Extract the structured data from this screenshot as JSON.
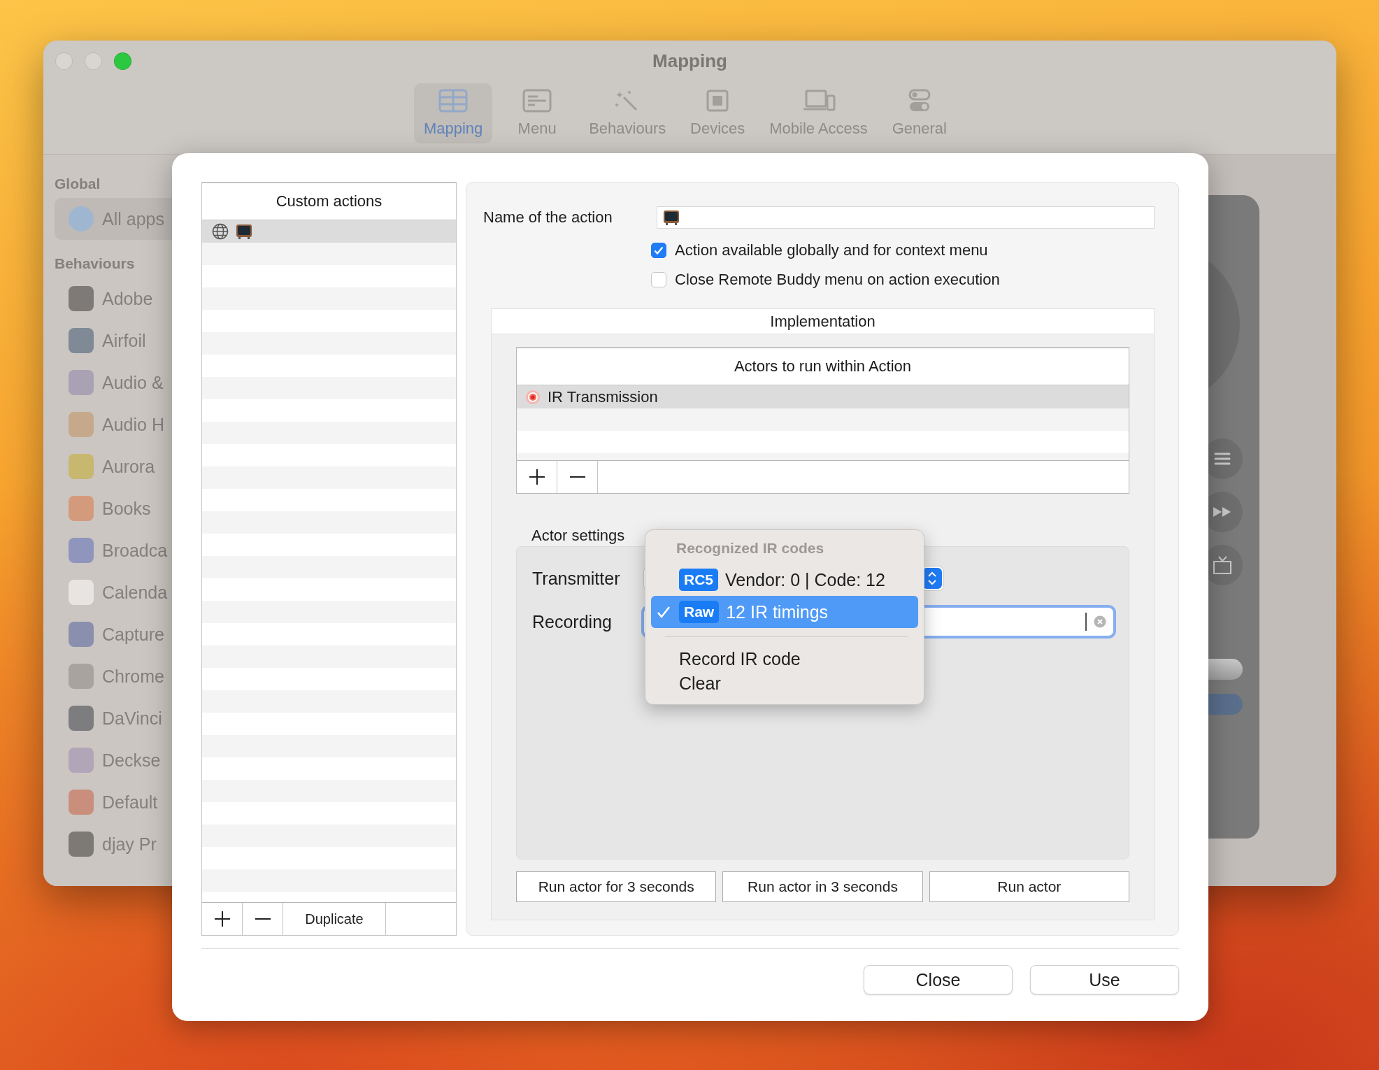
{
  "window": {
    "title": "Mapping"
  },
  "toolbar": [
    {
      "label": "Mapping",
      "selected": true
    },
    {
      "label": "Menu",
      "selected": false
    },
    {
      "label": "Behaviours",
      "selected": false
    },
    {
      "label": "Devices",
      "selected": false
    },
    {
      "label": "Mobile Access",
      "selected": false
    },
    {
      "label": "General",
      "selected": false
    }
  ],
  "sidebar": {
    "sections": [
      {
        "title": "Global",
        "items": [
          {
            "label": "All apps",
            "selected": true
          }
        ]
      },
      {
        "title": "Behaviours",
        "items": [
          {
            "label": "Adobe",
            "selected": false
          },
          {
            "label": "Airfoil",
            "selected": false
          },
          {
            "label": "Audio &",
            "selected": false
          },
          {
            "label": "Audio H",
            "selected": false
          },
          {
            "label": "Aurora",
            "selected": false
          },
          {
            "label": "Books",
            "selected": false
          },
          {
            "label": "Broadca",
            "selected": false
          },
          {
            "label": "Calenda",
            "selected": false
          },
          {
            "label": "Capture",
            "selected": false
          },
          {
            "label": "Chrome",
            "selected": false
          },
          {
            "label": "DaVinci",
            "selected": false
          },
          {
            "label": "Deckse",
            "selected": false
          },
          {
            "label": "Default",
            "selected": false
          },
          {
            "label": "djay Pr",
            "selected": false
          }
        ]
      }
    ]
  },
  "sheet": {
    "custom_actions": {
      "title": "Custom actions",
      "rows": [
        {
          "selected": true,
          "global": true
        }
      ],
      "duplicate_button": "Duplicate"
    },
    "name_field": {
      "label": "Name of the action"
    },
    "checkboxes": [
      {
        "label": "Action available globally and for context menu",
        "checked": true
      },
      {
        "label": "Close Remote Buddy menu on action execution",
        "checked": false
      }
    ],
    "implementation": {
      "title": "Implementation",
      "actors": {
        "title": "Actors to run within Action",
        "rows": [
          {
            "label": "IR Transmission",
            "selected": true
          }
        ]
      },
      "actor_settings": {
        "title": "Actor settings",
        "transmitter_label": "Transmitter",
        "recording_label": "Recording"
      },
      "run_buttons": [
        "Run actor for 3 seconds",
        "Run actor in 3 seconds",
        "Run actor"
      ]
    },
    "menu": {
      "header": "Recognized IR codes",
      "items": [
        {
          "kind": "code",
          "badge": "RC5",
          "label": "Vendor: 0 | Code: 12",
          "selected": false
        },
        {
          "kind": "code",
          "badge": "Raw",
          "label": "12 IR timings",
          "selected": true
        },
        {
          "kind": "separator"
        },
        {
          "kind": "command",
          "label": "Record IR code"
        },
        {
          "kind": "command",
          "label": "Clear"
        }
      ]
    },
    "dialog_buttons": [
      "Close",
      "Use"
    ]
  }
}
